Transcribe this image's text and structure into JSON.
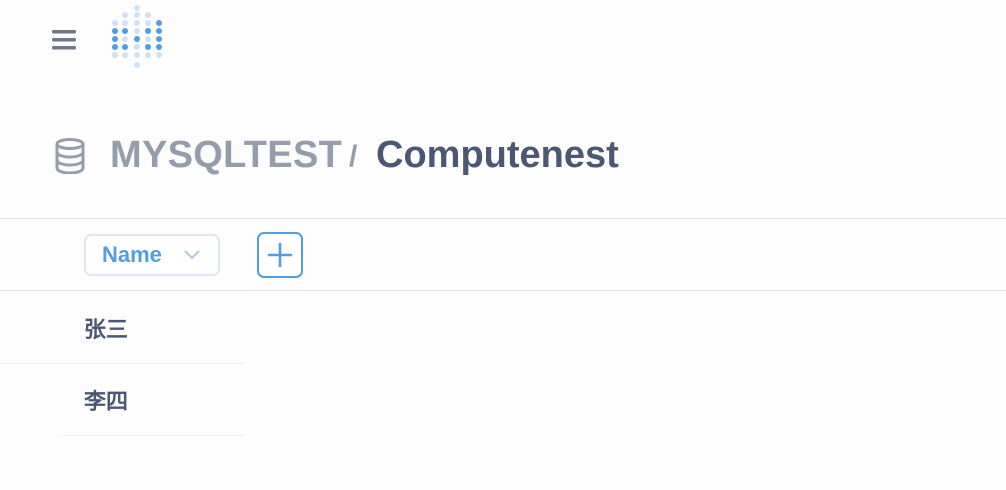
{
  "header": {
    "menu_icon": "hamburger-icon",
    "logo_icon": "metabase-logo-icon"
  },
  "breadcrumb": {
    "db_icon": "database-icon",
    "database": "MYSQLTEST",
    "separator": "/",
    "table": "Computenest"
  },
  "toolbar": {
    "column_select_label": "Name",
    "column_select_icon": "chevron-down-icon",
    "add_icon": "plus-icon"
  },
  "rows": [
    {
      "name": "张三"
    },
    {
      "name": "李四"
    }
  ],
  "colors": {
    "accent": "#509ee3",
    "text_dark": "#4c5773",
    "text_light": "#959dac"
  }
}
